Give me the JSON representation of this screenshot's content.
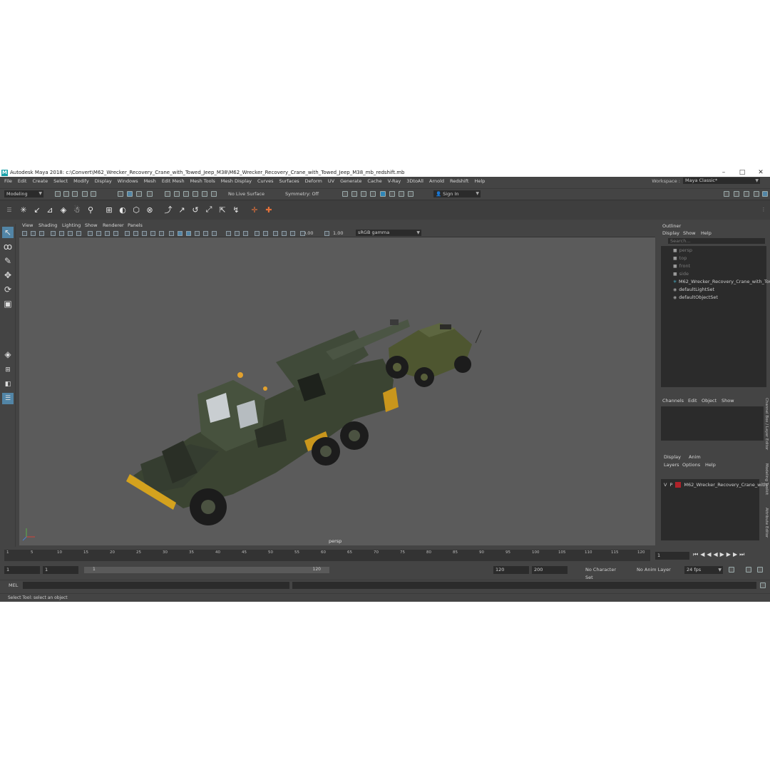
{
  "window": {
    "title": "Autodesk Maya 2018: c:\\Convert\\M62_Wrecker_Recovery_Crane_with_Towed_Jeep_M38\\M62_Wrecker_Recovery_Crane_with_Towed_Jeep_M38_mb_redshift.mb",
    "minimize": "–",
    "maximize": "□",
    "close": "✕"
  },
  "menubar": {
    "items": [
      "File",
      "Edit",
      "Create",
      "Select",
      "Modify",
      "Display",
      "Windows",
      "Mesh",
      "Edit Mesh",
      "Mesh Tools",
      "Mesh Display",
      "Curves",
      "Surfaces",
      "Deform",
      "UV",
      "Generate",
      "Cache",
      "V-Ray",
      "3DtoAll",
      "Arnold",
      "Redshift",
      "Help"
    ],
    "workspace_label": "Workspace :",
    "workspace_value": "Maya Classic*"
  },
  "statusline": {
    "menuset": "Modeling",
    "live_surface": "No Live Surface",
    "symmetry": "Symmetry: Off",
    "sign_in": "Sign In"
  },
  "viewport": {
    "menus": [
      "View",
      "Shading",
      "Lighting",
      "Show",
      "Renderer",
      "Panels"
    ],
    "exposure": "0.00",
    "gamma": "1.00",
    "color_space": "sRGB gamma",
    "camera_label": "persp"
  },
  "outliner": {
    "title": "Outliner",
    "menus": [
      "Display",
      "Show",
      "Help"
    ],
    "search_placeholder": "Search...",
    "items": [
      {
        "label": "persp",
        "dim": true
      },
      {
        "label": "top",
        "dim": true
      },
      {
        "label": "front",
        "dim": true
      },
      {
        "label": "side",
        "dim": true
      },
      {
        "label": "M62_Wrecker_Recovery_Crane_with_Tow",
        "dim": false
      },
      {
        "label": "defaultLightSet",
        "dim": false
      },
      {
        "label": "defaultObjectSet",
        "dim": false
      }
    ]
  },
  "channelbox": {
    "menus": [
      "Channels",
      "Edit",
      "Object",
      "Show"
    ]
  },
  "layereditor": {
    "tabs": [
      "Display",
      "Anim"
    ],
    "menus": [
      "Layers",
      "Options",
      "Help"
    ],
    "layer": {
      "v": "V",
      "p": "P",
      "name": "M62_Wrecker_Recovery_Crane_with",
      "color": "#b0222a"
    }
  },
  "side_tabs": [
    "Channel Box / Layer Editor",
    "Modeling Toolkit",
    "Attribute Editor"
  ],
  "timeline": {
    "ticks": [
      "1",
      "5",
      "10",
      "15",
      "20",
      "25",
      "30",
      "35",
      "40",
      "45",
      "50",
      "55",
      "60",
      "65",
      "70",
      "75",
      "80",
      "85",
      "90",
      "95",
      "100",
      "105",
      "110",
      "115",
      "120"
    ],
    "current_frame": "1"
  },
  "range": {
    "start": "1",
    "playback_start": "1",
    "slider_start": "1",
    "slider_end": "120",
    "playback_end": "120",
    "end": "200",
    "character_set": "No Character Set",
    "anim_layer": "No Anim Layer",
    "fps": "24 fps"
  },
  "cmdline": {
    "label": "MEL"
  },
  "helpline": {
    "text": "Select Tool: select an object"
  },
  "colors": {
    "ui_bg": "#444444",
    "viewport_bg": "#5b5b5b",
    "field_bg": "#2b2b2b",
    "accent": "#5285a6"
  }
}
